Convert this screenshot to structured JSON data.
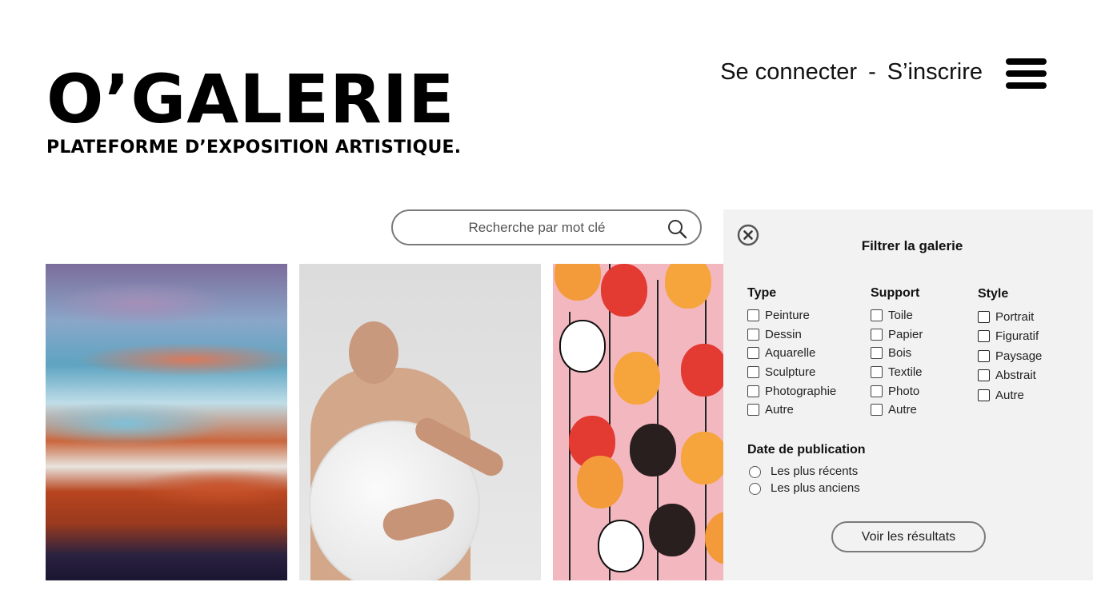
{
  "header": {
    "logo": "O’GALERIE",
    "tagline": "PLATEFORME D’EXPOSITION ARTISTIQUE.",
    "login_label": "Se connecter",
    "separator": "-",
    "signup_label": "S’inscrire",
    "menu_icon": "hamburger-menu-icon"
  },
  "search": {
    "placeholder": "Recherche par mot clé",
    "icon": "search-icon"
  },
  "gallery": {
    "images": [
      {
        "subject": "abstract-fluid-painting"
      },
      {
        "subject": "man-holding-round-mirror"
      },
      {
        "subject": "illustrated-faces-pattern"
      }
    ]
  },
  "filter": {
    "close_icon": "close-circle-icon",
    "title": "Filtrer la galerie",
    "type": {
      "heading": "Type",
      "options": [
        "Peinture",
        "Dessin",
        "Aquarelle",
        "Sculpture",
        "Photographie",
        "Autre"
      ]
    },
    "support": {
      "heading": "Support",
      "options": [
        "Toile",
        "Papier",
        "Bois",
        "Textile",
        "Photo",
        "Autre"
      ]
    },
    "style": {
      "heading": "Style",
      "options": [
        "Portrait",
        "Figuratif",
        "Paysage",
        "Abstrait",
        "Autre"
      ]
    },
    "date": {
      "heading": "Date de publication",
      "options": [
        "Les plus récents",
        "Les plus anciens"
      ]
    },
    "submit_label": "Voir les résultats"
  }
}
